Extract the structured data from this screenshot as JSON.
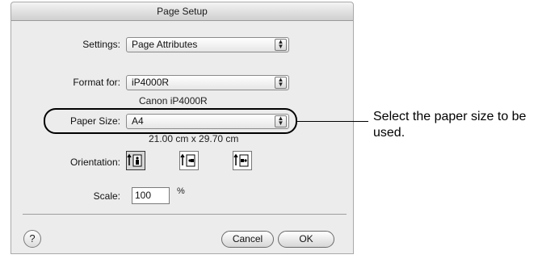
{
  "dialog": {
    "title": "Page Setup",
    "settings": {
      "label": "Settings:",
      "value": "Page Attributes"
    },
    "format_for": {
      "label": "Format for:",
      "value": "iP4000R",
      "description": "Canon iP4000R"
    },
    "paper_size": {
      "label": "Paper Size:",
      "value": "A4",
      "dimensions": "21.00 cm x 29.70 cm"
    },
    "orientation": {
      "label": "Orientation:",
      "options": [
        "portrait",
        "landscape-left",
        "landscape-right"
      ],
      "selected": "portrait"
    },
    "scale": {
      "label": "Scale:",
      "value": "100",
      "unit": "%"
    },
    "help_label": "?",
    "cancel_label": "Cancel",
    "ok_label": "OK"
  },
  "callout": {
    "text": "Select the paper size to be used."
  }
}
